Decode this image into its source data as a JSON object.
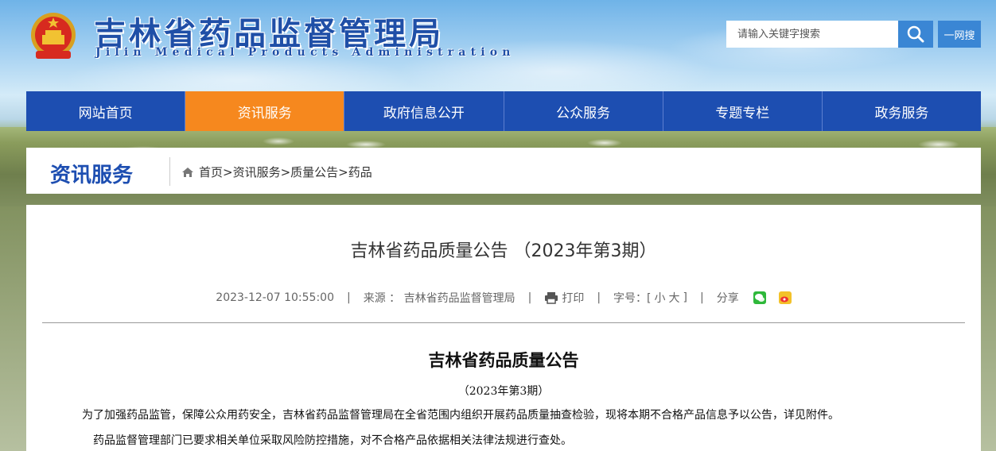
{
  "header": {
    "title": "吉林省药品监督管理局",
    "subtitle": "Jilin Medical Products Administration",
    "search_placeholder": "请输入关键字搜索",
    "search_button_icon": "search-icon",
    "yiwang_label": "一网搜"
  },
  "nav": {
    "items": [
      {
        "label": "网站首页"
      },
      {
        "label": "资讯服务",
        "active": true
      },
      {
        "label": "政府信息公开"
      },
      {
        "label": "公众服务"
      },
      {
        "label": "专题专栏"
      },
      {
        "label": "政务服务"
      }
    ],
    "colors": {
      "default": "#1d4eb1",
      "active": "#f6881e"
    }
  },
  "section": {
    "title": "资讯服务",
    "breadcrumb_icon": "home-icon",
    "breadcrumb": "首页>资讯服务>质量公告>药品"
  },
  "article": {
    "title": "吉林省药品质量公告 （2023年第3期）",
    "datetime": "2023-12-07 10:55:00",
    "sep": "|",
    "source": "来源 ： 吉林省药品监督管理局",
    "print_label": "打印",
    "fontsize_label": "字号：[",
    "font_small": "小",
    "font_large": "大",
    "fontsize_close": "]",
    "share_label": "分享",
    "doc_title": "吉林省药品质量公告",
    "doc_issue": "（2023年第3期）",
    "para1": "为了加强药品监管，保障公众用药安全，吉林省药品监督管理局在全省范围内组织开展药品质量抽查检验，现将本期不合格产品信息予以公告，详见附件。",
    "para2": "药品监督管理部门已要求相关单位采取风险防控措施，对不合格产品依据相关法律法规进行查处。"
  }
}
